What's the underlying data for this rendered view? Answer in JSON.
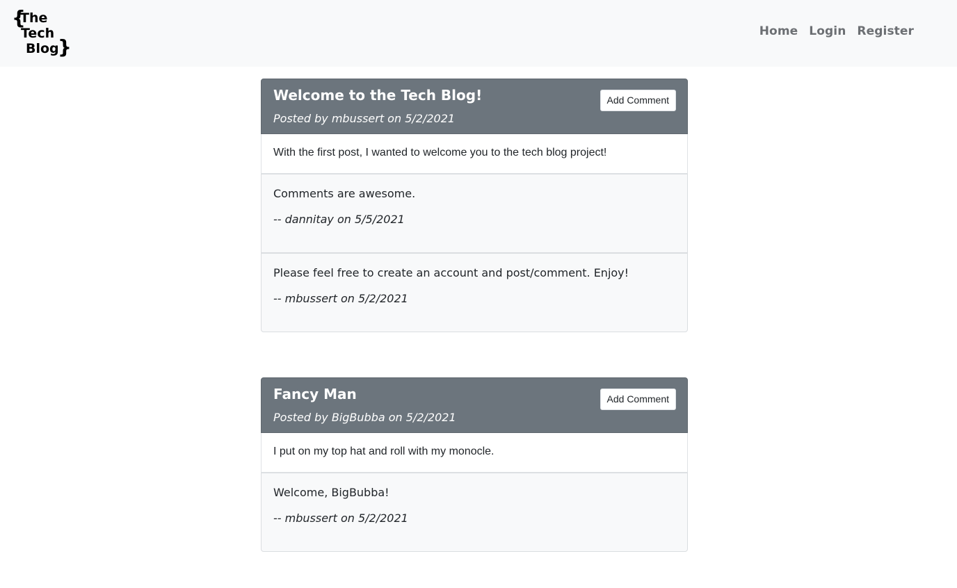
{
  "nav": {
    "logo_text": [
      "{The",
      "Tech",
      "Blog}"
    ],
    "links": [
      "Home",
      "Login",
      "Register"
    ]
  },
  "posts": [
    {
      "title": "Welcome to the Tech Blog!",
      "meta": "Posted by mbussert on 5/2/2021",
      "add_comment_label": "Add Comment",
      "body": "With the first post, I wanted to welcome you to the tech blog project!",
      "comments": [
        {
          "text": "Comments are awesome.",
          "author": "-- dannitay on 5/5/2021"
        },
        {
          "text": "Please feel free to create an account and post/comment. Enjoy!",
          "author": "-- mbussert on 5/2/2021"
        }
      ]
    },
    {
      "title": "Fancy Man",
      "meta": "Posted by BigBubba on 5/2/2021",
      "add_comment_label": "Add Comment",
      "body": "I put on my top hat and roll with my monocle.",
      "comments": [
        {
          "text": "Welcome, BigBubba!",
          "author": "-- mbussert on 5/2/2021"
        }
      ]
    }
  ]
}
